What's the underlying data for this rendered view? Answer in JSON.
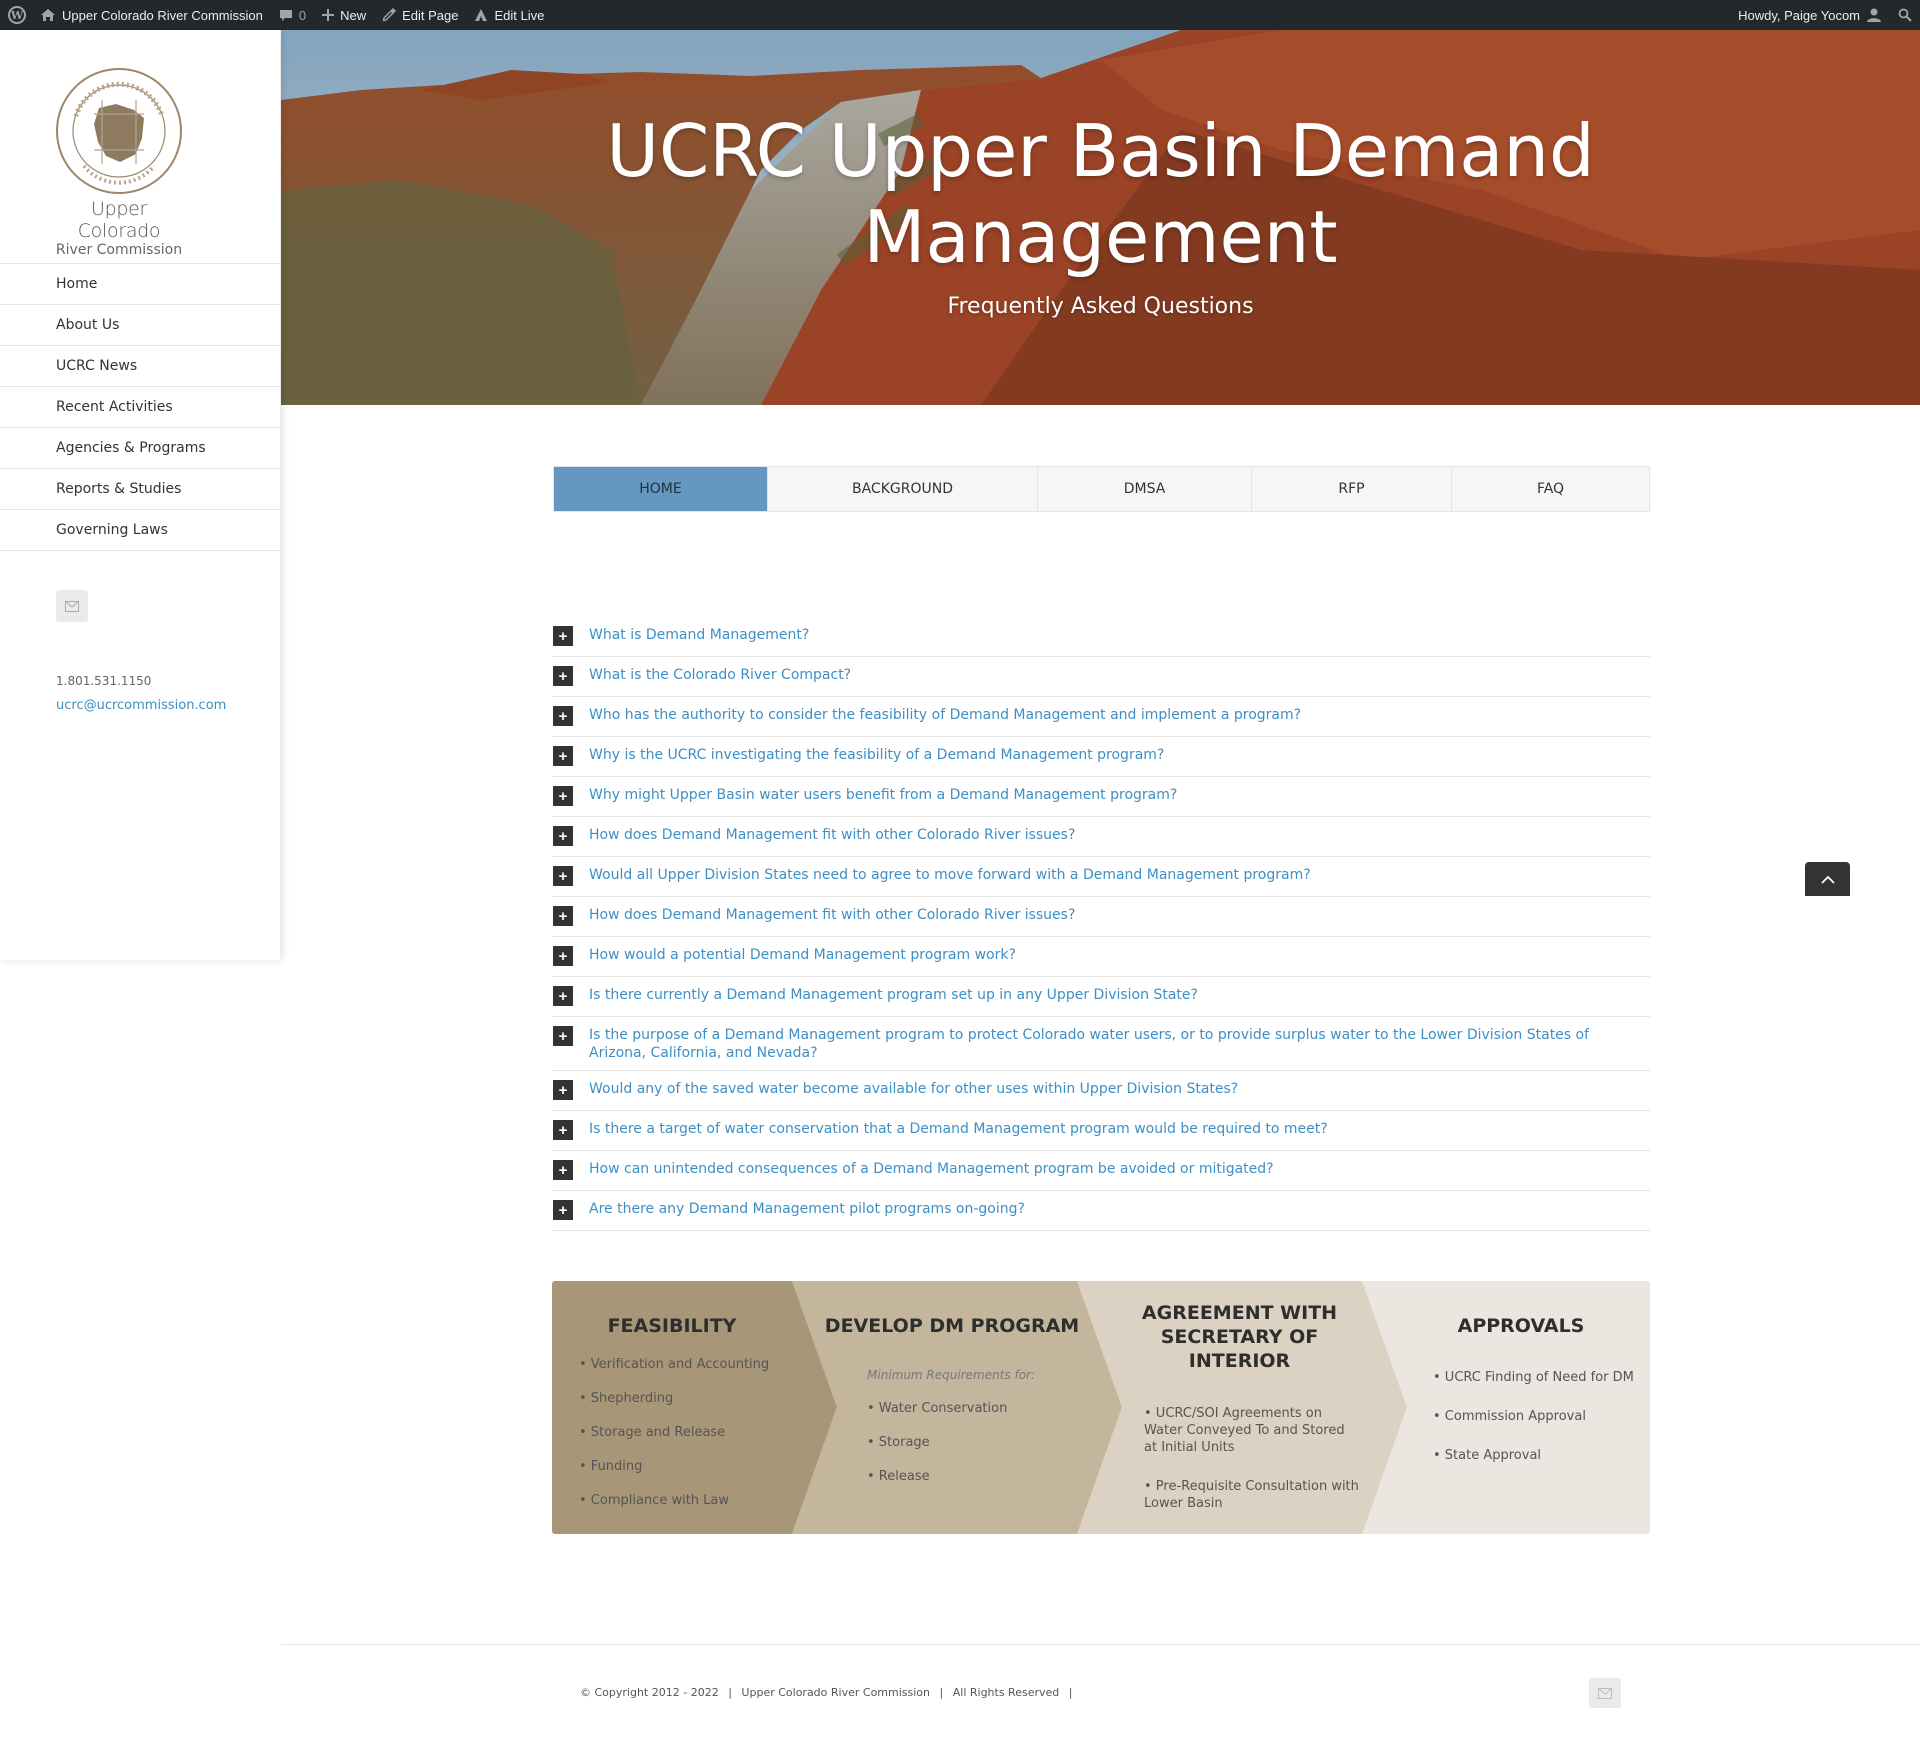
{
  "admin_bar": {
    "site_name": "Upper Colorado River Commission",
    "comments_count": "0",
    "new_label": "New",
    "edit_page_label": "Edit Page",
    "edit_live_label": "Edit Live",
    "howdy": "Howdy, Paige Yocom",
    "icons": [
      "wordpress-icon",
      "home-icon",
      "comment-icon",
      "plus-icon",
      "pencil-icon",
      "edit-live-icon",
      "user-icon",
      "search-icon"
    ]
  },
  "sidebar": {
    "logo_line1": "Upper Colorado",
    "logo_line2": "River Commission",
    "seal_text": "UPPER COLORADO RIVER COMMISSION",
    "seal_date": "APRIL 6, 1949",
    "nav": [
      "Home",
      "About Us",
      "UCRC News",
      "Recent Activities",
      "Agencies & Programs",
      "Reports & Studies",
      "Governing Laws"
    ],
    "phone": "1.801.531.1150",
    "email": "ucrc@ucrcommission.com"
  },
  "hero": {
    "title_line1": "UCRC Upper Basin Demand",
    "title_line2": "Management",
    "subtitle": "Frequently Asked Questions"
  },
  "tabs": [
    {
      "label": "HOME",
      "active": true
    },
    {
      "label": "BACKGROUND",
      "active": false
    },
    {
      "label": "DMSA",
      "active": false
    },
    {
      "label": "RFP",
      "active": false
    },
    {
      "label": "FAQ",
      "active": false
    }
  ],
  "faq": [
    "What is Demand Management?",
    "What is the Colorado River Compact?",
    "Who has the authority to consider the feasibility of Demand Management and implement a program?",
    "Why is the UCRC investigating the feasibility of a Demand Management program?",
    "Why might Upper Basin water users benefit from a Demand Management program?",
    "How does Demand Management fit with other Colorado River issues?",
    "Would all Upper Division States need to agree to move forward with a Demand Management program?",
    "How does Demand Management fit with other Colorado River issues?",
    "How would a potential Demand Management program work?",
    "Is there currently a Demand Management program set up in any Upper Division State?",
    "Is the purpose of a Demand Management program to protect Colorado water users, or to provide surplus water to the Lower Division States of Arizona, California, and Nevada?",
    "Would any of the saved water become available for other uses within Upper Division States?",
    "Is there a target of water conservation that a Demand Management program would be required to meet?",
    "How can unintended consequences of a Demand Management program be avoided or mitigated?",
    "Are there any Demand Management pilot programs on-going?"
  ],
  "process": {
    "stage1": {
      "title": "FEASIBILITY",
      "items": [
        "• Verification and Accounting",
        "• Shepherding",
        "• Storage and Release",
        "• Funding",
        "• Compliance with Law"
      ]
    },
    "stage2": {
      "title": "DEVELOP DM PROGRAM",
      "note": "Minimum Requirements for:",
      "items": [
        "• Water Conservation",
        "• Storage",
        "• Release"
      ]
    },
    "stage3": {
      "title_line1": "AGREEMENT WITH",
      "title_line2": "SECRETARY OF INTERIOR",
      "items": [
        "• UCRC/SOI Agreements on Water Conveyed To and Stored at Initial Units",
        "• Pre-Requisite Consultation with Lower Basin"
      ]
    },
    "stage4": {
      "title": "APPROVALS",
      "items": [
        "• UCRC Finding of Need for DM",
        "• Commission Approval",
        "• State Approval"
      ]
    },
    "colors": [
      "#a89679",
      "#c4b59d",
      "#dcd2c3",
      "#ebe6df"
    ]
  },
  "footer": {
    "copyright": "© Copyright 2012 - 2022",
    "sep": "|",
    "org": "Upper Colorado River Commission",
    "rights": "All Rights Reserved"
  }
}
